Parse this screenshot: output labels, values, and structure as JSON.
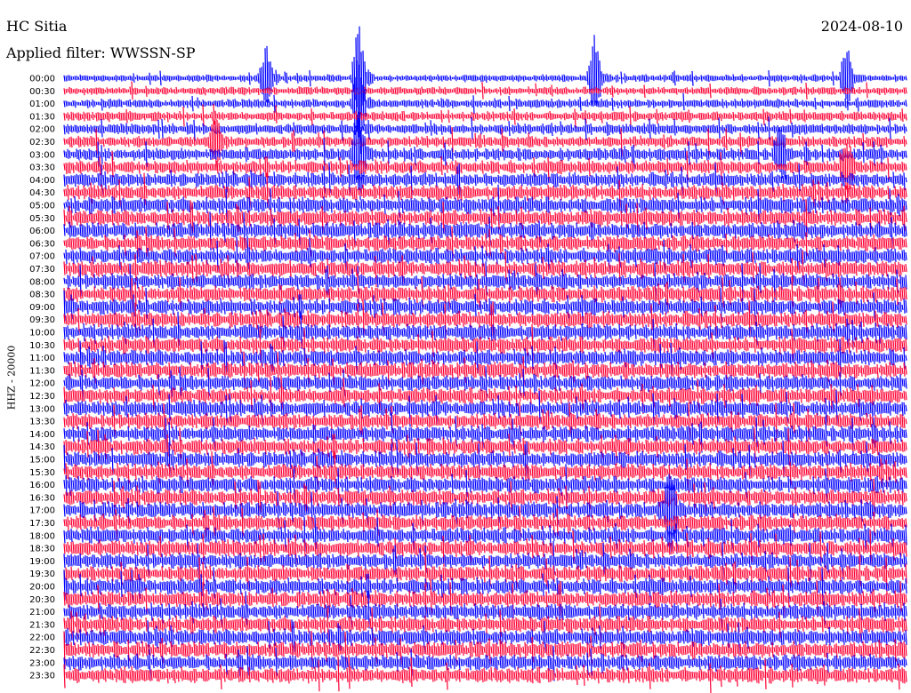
{
  "header": {
    "station": "HC Sitia",
    "date": "2024-08-10",
    "filter": "Applied filter: WWSSN-SP"
  },
  "chart_data": {
    "type": "line",
    "title": "HC Sitia",
    "ylabel": "HHZ - 20000",
    "grid": false,
    "row_labels": [
      "00:00",
      "00:30",
      "01:00",
      "01:30",
      "02:00",
      "02:30",
      "03:00",
      "03:30",
      "04:00",
      "04:30",
      "05:00",
      "05:30",
      "06:00",
      "06:30",
      "07:00",
      "07:30",
      "08:00",
      "08:30",
      "09:00",
      "09:30",
      "10:00",
      "10:30",
      "11:00",
      "11:30",
      "12:00",
      "12:30",
      "13:00",
      "13:30",
      "14:00",
      "14:30",
      "15:00",
      "15:30",
      "16:00",
      "16:30",
      "17:00",
      "17:30",
      "18:00",
      "18:30",
      "19:00",
      "19:30",
      "20:00",
      "20:30",
      "21:00",
      "21:30",
      "22:00",
      "22:30",
      "23:00",
      "23:30"
    ],
    "series_colors": [
      "#0000ff",
      "#ff0033"
    ],
    "events": [
      {
        "row": "00:00",
        "position": 0.24,
        "strength": 0.9
      },
      {
        "row": "00:00",
        "position": 0.35,
        "strength": 1.6
      },
      {
        "row": "00:00",
        "position": 0.63,
        "strength": 1.2
      },
      {
        "row": "00:00",
        "position": 0.93,
        "strength": 1.0
      },
      {
        "row": "01:00",
        "position": 0.35,
        "strength": 1.5
      },
      {
        "row": "02:30",
        "position": 0.18,
        "strength": 0.7
      },
      {
        "row": "03:00",
        "position": 0.35,
        "strength": 1.4
      },
      {
        "row": "03:00",
        "position": 0.85,
        "strength": 0.7
      },
      {
        "row": "03:30",
        "position": 0.93,
        "strength": 0.8
      },
      {
        "row": "17:00",
        "position": 0.72,
        "strength": 1.3
      }
    ]
  }
}
